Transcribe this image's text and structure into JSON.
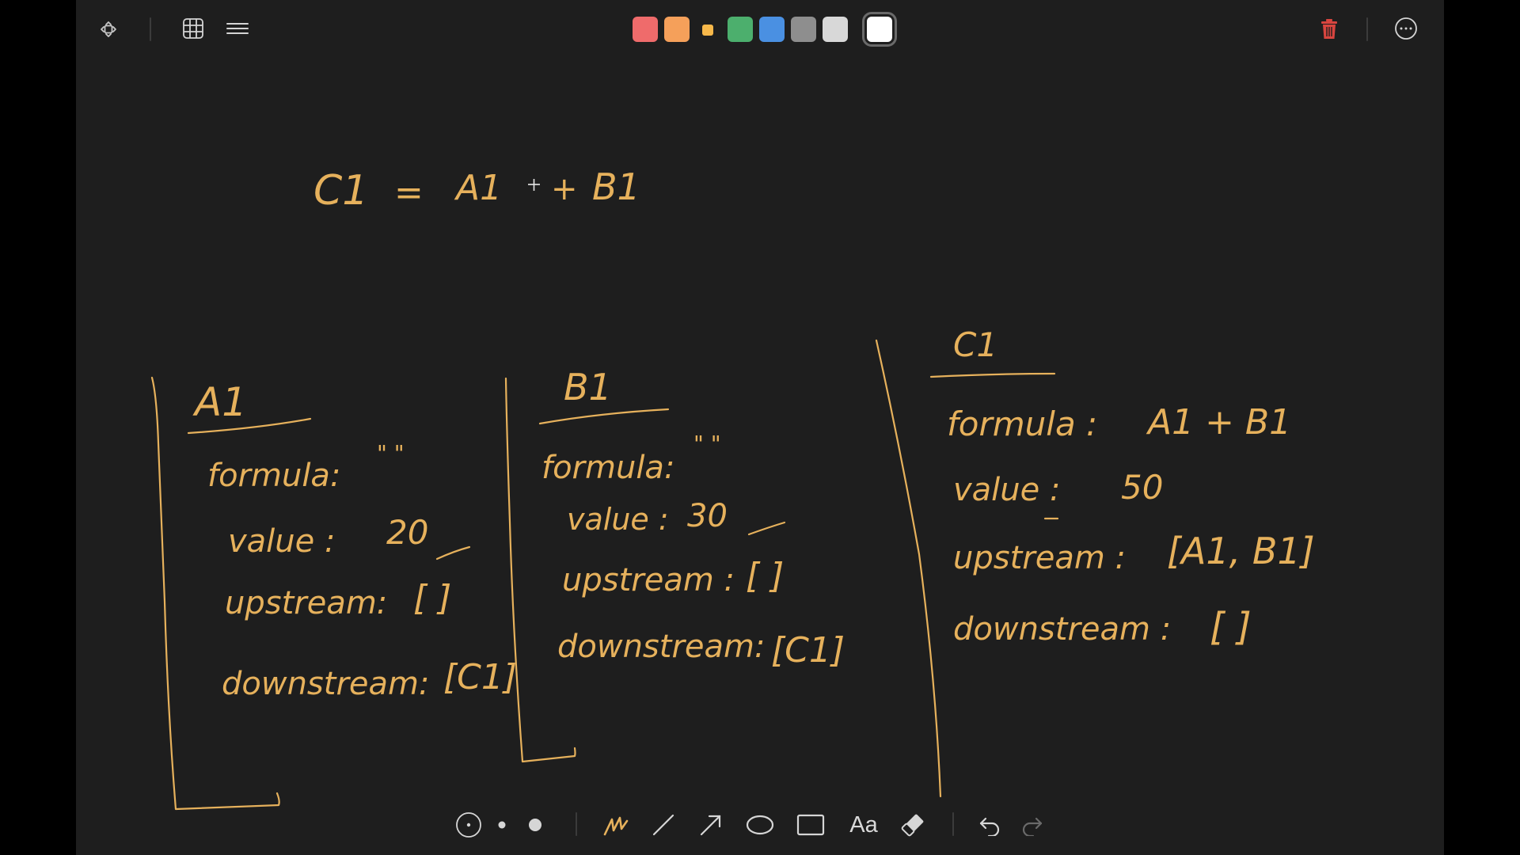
{
  "toolbar": {
    "colors": [
      "#ef6b6b",
      "#f5a05a",
      "#f7b84a",
      "#4caf6d",
      "#4a90e2",
      "#8e8e8e",
      "#d8d8d8",
      "#ffffff"
    ],
    "selected_color_index": 7
  },
  "bottom_toolbar": {
    "text_tool_label": "Aa"
  },
  "canvas": {
    "ink_color": "#e6b15c",
    "formula_line": {
      "lhs": "C1",
      "eq": "=",
      "a": "A1",
      "plus": "+",
      "b": "B1"
    },
    "cells": [
      {
        "name": "A1",
        "formula_label": "formula:",
        "formula_value": "\" \"",
        "value_label": "value :",
        "value": "20",
        "upstream_label": "upstream:",
        "upstream": "[ ]",
        "downstream_label": "downstream:",
        "downstream": "[C1]"
      },
      {
        "name": "B1",
        "formula_label": "formula:",
        "formula_value": "\" \"",
        "value_label": "value :",
        "value": "30",
        "upstream_label": "upstream :",
        "upstream": "[ ]",
        "downstream_label": "downstream:",
        "downstream": "[C1]"
      },
      {
        "name": "C1",
        "formula_label": "formula :",
        "formula_value": "A1 + B1",
        "value_label": "value :",
        "value": "50",
        "upstream_label": "upstream :",
        "upstream": "[A1, B1]",
        "downstream_label": "downstream :",
        "downstream": "[ ]"
      }
    ]
  }
}
